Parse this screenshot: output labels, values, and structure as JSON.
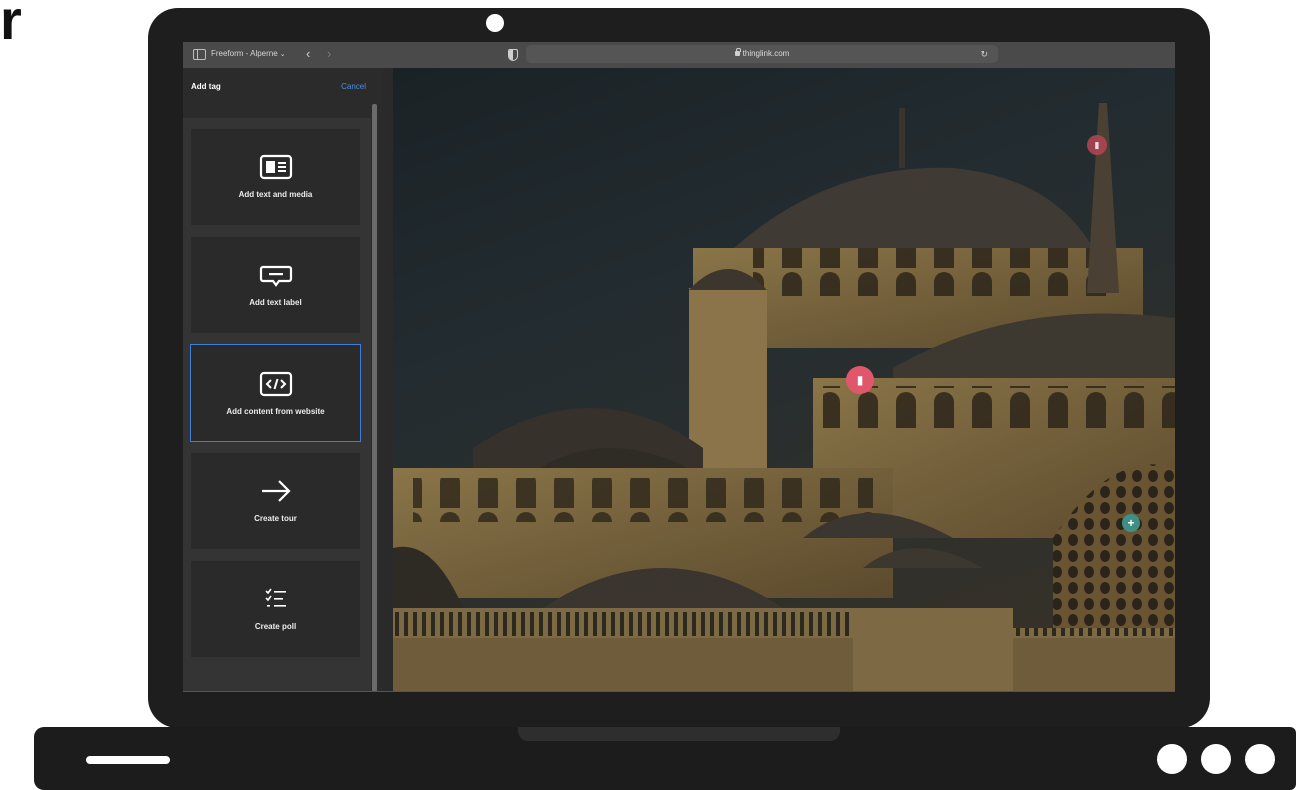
{
  "page": {
    "corner_letter": "r"
  },
  "browser": {
    "tab_group": "Freeform - Alperne",
    "url": "thinglink.com",
    "back_icon": "chevron-left-icon",
    "forward_icon": "chevron-right-icon"
  },
  "panel": {
    "title": "Add tag",
    "cancel_label": "Cancel",
    "cards": [
      {
        "label": "Add text and media",
        "icon": "text-media-icon",
        "selected": false
      },
      {
        "label": "Add text label",
        "icon": "speech-label-icon",
        "selected": false
      },
      {
        "label": "Add content from website",
        "icon": "code-icon",
        "selected": true
      },
      {
        "label": "Create tour",
        "icon": "arrow-right-icon",
        "selected": false
      },
      {
        "label": "Create poll",
        "icon": "checklist-icon",
        "selected": false
      }
    ]
  },
  "canvas": {
    "image_subject": "mosque",
    "hotspots": [
      {
        "icon": "map-icon",
        "color": "#e0566b"
      },
      {
        "icon": "map-icon",
        "color": "#e0566b"
      },
      {
        "icon": "plus-circle-icon",
        "color": "#3f8f86"
      }
    ]
  },
  "colors": {
    "accent": "#3d7fd9",
    "cancel": "#4a8fe0",
    "tag": "#e0566b"
  }
}
